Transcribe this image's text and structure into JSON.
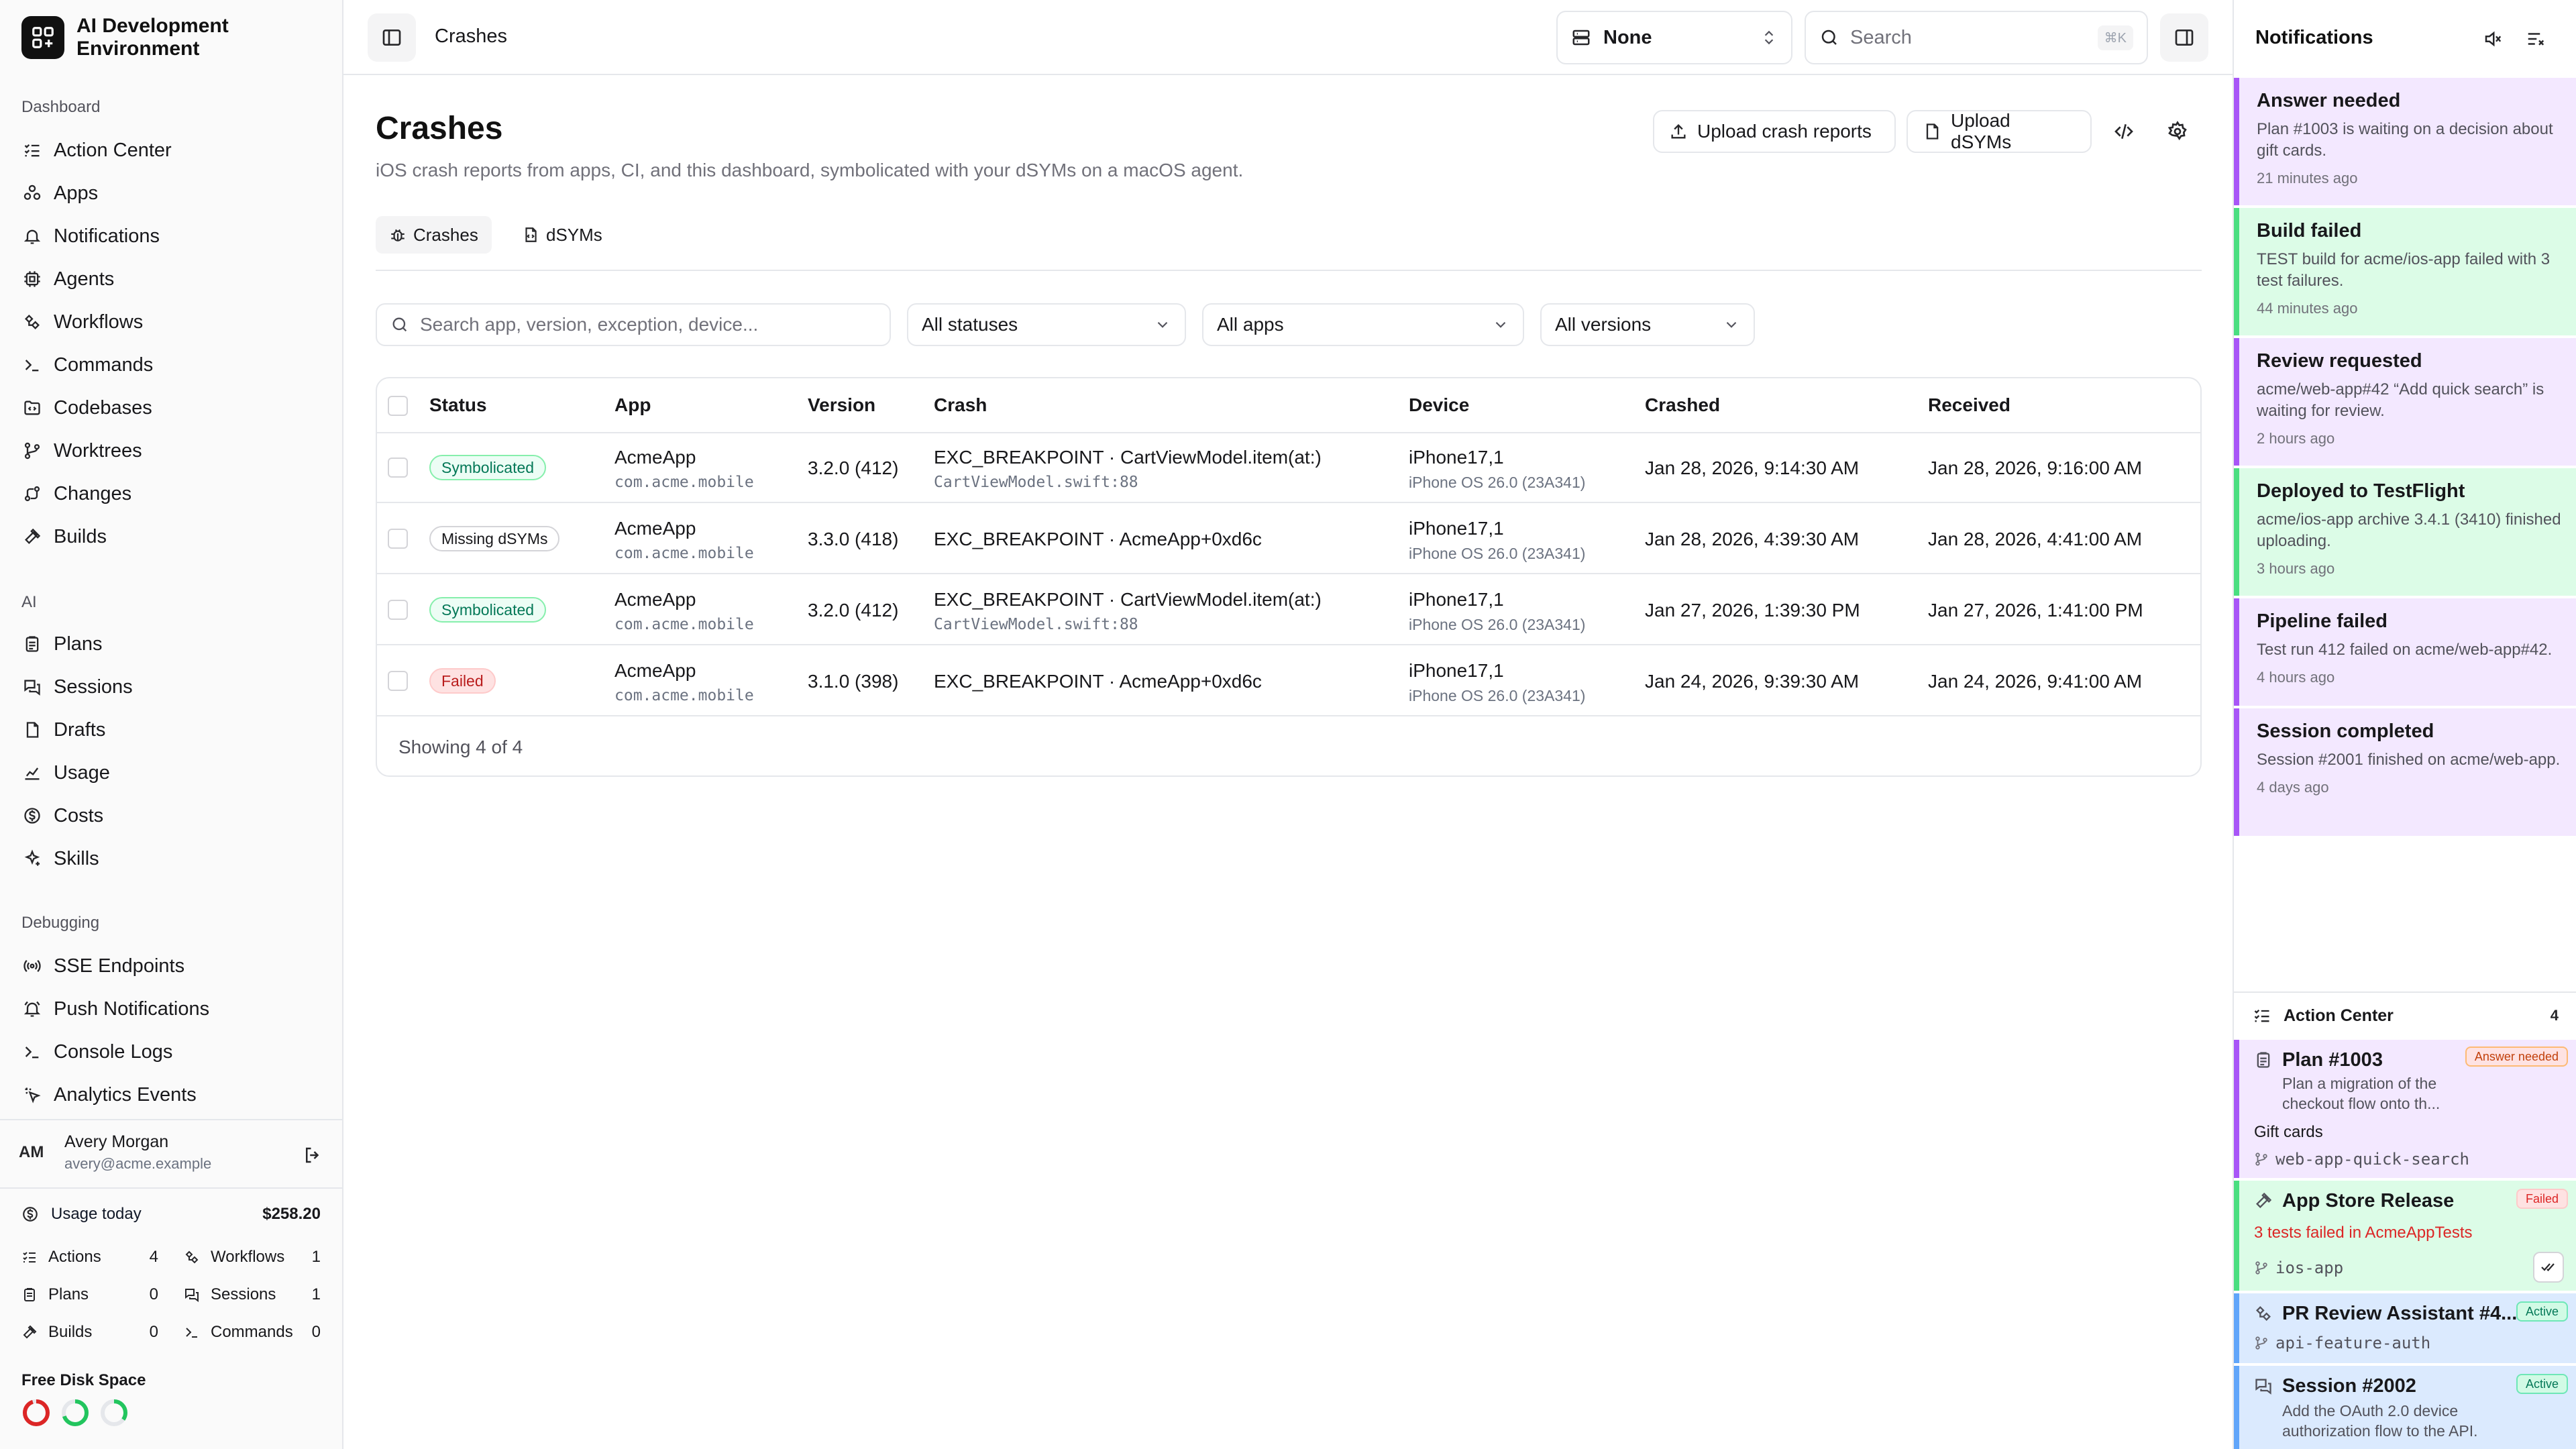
{
  "app": {
    "name": "AI Development Environment"
  },
  "sidebar": {
    "sections": [
      {
        "label": "Dashboard",
        "items": [
          {
            "label": "Action Center",
            "icon": "list-checks-icon"
          },
          {
            "label": "Apps",
            "icon": "apps-icon"
          },
          {
            "label": "Notifications",
            "icon": "bell-icon"
          },
          {
            "label": "Agents",
            "icon": "cpu-icon"
          },
          {
            "label": "Workflows",
            "icon": "workflow-icon"
          },
          {
            "label": "Commands",
            "icon": "terminal-icon"
          },
          {
            "label": "Codebases",
            "icon": "folder-code-icon"
          },
          {
            "label": "Worktrees",
            "icon": "git-branch-icon"
          },
          {
            "label": "Changes",
            "icon": "git-compare-icon"
          },
          {
            "label": "Builds",
            "icon": "hammer-icon"
          }
        ]
      },
      {
        "label": "AI",
        "items": [
          {
            "label": "Plans",
            "icon": "clipboard-icon"
          },
          {
            "label": "Sessions",
            "icon": "messages-icon"
          },
          {
            "label": "Drafts",
            "icon": "drafts-icon"
          },
          {
            "label": "Usage",
            "icon": "chart-icon"
          },
          {
            "label": "Costs",
            "icon": "dollar-icon"
          },
          {
            "label": "Skills",
            "icon": "sparkles-icon"
          }
        ]
      },
      {
        "label": "Debugging",
        "items": [
          {
            "label": "SSE Endpoints",
            "icon": "radio-icon"
          },
          {
            "label": "Push Notifications",
            "icon": "bell-ring-icon"
          },
          {
            "label": "Console Logs",
            "icon": "terminal-icon"
          },
          {
            "label": "Analytics Events",
            "icon": "pointer-icon"
          }
        ]
      }
    ],
    "user": {
      "initials": "AM",
      "name": "Avery Morgan",
      "email": "avery@acme.example"
    },
    "usage": {
      "label": "Usage today",
      "value": "$258.20"
    },
    "stats": [
      {
        "label": "Actions",
        "value": "4",
        "icon": "list-checks-icon"
      },
      {
        "label": "Workflows",
        "value": "1",
        "icon": "workflow-icon"
      },
      {
        "label": "Plans",
        "value": "0",
        "icon": "clipboard-icon"
      },
      {
        "label": "Sessions",
        "value": "1",
        "icon": "messages-icon"
      },
      {
        "label": "Builds",
        "value": "0",
        "icon": "hammer-icon"
      },
      {
        "label": "Commands",
        "value": "0",
        "icon": "terminal-icon"
      }
    ],
    "disk": {
      "label": "Free Disk Space",
      "rings": [
        {
          "color": "#dc2626",
          "fraction": 0.95
        },
        {
          "color": "#22c55e",
          "fraction": 0.7
        },
        {
          "color": "#22c55e",
          "fraction": 0.35
        }
      ]
    }
  },
  "topbar": {
    "breadcrumb": "Crashes",
    "scheme_value": "None",
    "search_placeholder": "Search",
    "search_shortcut": "⌘K"
  },
  "page": {
    "title": "Crashes",
    "subtitle": "iOS crash reports from apps, CI, and this dashboard, symbolicated with your dSYMs on a macOS agent.",
    "actions": {
      "upload_crash": "Upload crash reports",
      "upload_dsyms": "Upload dSYMs"
    },
    "tabs": [
      {
        "label": "Crashes"
      },
      {
        "label": "dSYMs"
      }
    ],
    "filters": {
      "search_placeholder": "Search app, version, exception, device...",
      "status": "All statuses",
      "app": "All apps",
      "version": "All versions"
    }
  },
  "table": {
    "columns": [
      "Status",
      "App",
      "Version",
      "Crash",
      "Device",
      "Crashed",
      "Received"
    ],
    "rows": [
      {
        "status": "Symbolicated",
        "status_kind": "symbolicated",
        "app": "AcmeApp",
        "bundle": "com.acme.mobile",
        "version": "3.2.0 (412)",
        "crash": "EXC_BREAKPOINT · CartViewModel.item(at:)",
        "crash_location": "CartViewModel.swift:88",
        "device": "iPhone17,1",
        "os": "iPhone OS 26.0 (23A341)",
        "crashed": "Jan 28, 2026, 9:14:30 AM",
        "received": "Jan 28, 2026, 9:16:00 AM"
      },
      {
        "status": "Missing dSYMs",
        "status_kind": "missing",
        "app": "AcmeApp",
        "bundle": "com.acme.mobile",
        "version": "3.3.0 (418)",
        "crash": "EXC_BREAKPOINT · AcmeApp+0xd6c",
        "crash_location": "",
        "device": "iPhone17,1",
        "os": "iPhone OS 26.0 (23A341)",
        "crashed": "Jan 28, 2026, 4:39:30 AM",
        "received": "Jan 28, 2026, 4:41:00 AM"
      },
      {
        "status": "Symbolicated",
        "status_kind": "symbolicated",
        "app": "AcmeApp",
        "bundle": "com.acme.mobile",
        "version": "3.2.0 (412)",
        "crash": "EXC_BREAKPOINT · CartViewModel.item(at:)",
        "crash_location": "CartViewModel.swift:88",
        "device": "iPhone17,1",
        "os": "iPhone OS 26.0 (23A341)",
        "crashed": "Jan 27, 2026, 1:39:30 PM",
        "received": "Jan 27, 2026, 1:41:00 PM"
      },
      {
        "status": "Failed",
        "status_kind": "failed",
        "app": "AcmeApp",
        "bundle": "com.acme.mobile",
        "version": "3.1.0 (398)",
        "crash": "EXC_BREAKPOINT · AcmeApp+0xd6c",
        "crash_location": "",
        "device": "iPhone17,1",
        "os": "iPhone OS 26.0 (23A341)",
        "crashed": "Jan 24, 2026, 9:39:30 AM",
        "received": "Jan 24, 2026, 9:41:00 AM"
      }
    ],
    "footer": "Showing 4 of 4"
  },
  "notifications": {
    "title": "Notifications",
    "items": [
      {
        "title": "Answer needed",
        "body": "Plan #1003 is waiting on a decision about gift cards.",
        "time": "21 minutes ago",
        "color": "purple"
      },
      {
        "title": "Build failed",
        "body": "TEST build for acme/ios-app failed with 3 test failures.",
        "time": "44 minutes ago",
        "color": "green"
      },
      {
        "title": "Review requested",
        "body": "acme/web-app#42 “Add quick search” is waiting for review.",
        "time": "2 hours ago",
        "color": "purple"
      },
      {
        "title": "Deployed to TestFlight",
        "body": "acme/ios-app archive 3.4.1 (3410) finished uploading.",
        "time": "3 hours ago",
        "color": "green"
      },
      {
        "title": "Pipeline failed",
        "body": "Test run 412 failed on acme/web-app#42.",
        "time": "4 hours ago",
        "color": "purple"
      },
      {
        "title": "Session completed",
        "body": "Session #2001 finished on acme/web-app.",
        "time": "4 days ago",
        "color": "purple"
      }
    ]
  },
  "action_center": {
    "title": "Action Center",
    "count": "4",
    "plan": {
      "title": "Plan #1003",
      "badge": "Answer needed",
      "desc": "Plan a migration of the checkout flow onto th...",
      "topic": "Gift cards",
      "branch": "web-app-quick-search"
    },
    "release": {
      "title": "App Store Release",
      "badge": "Failed",
      "error": "3 tests failed in AcmeAppTests",
      "branch": "ios-app"
    },
    "review": {
      "title": "PR Review Assistant #4...",
      "badge": "Active",
      "branch": "api-feature-auth"
    },
    "session": {
      "title": "Session #2002",
      "badge": "Active",
      "desc": "Add the OAuth 2.0 device authorization flow to the API."
    }
  }
}
